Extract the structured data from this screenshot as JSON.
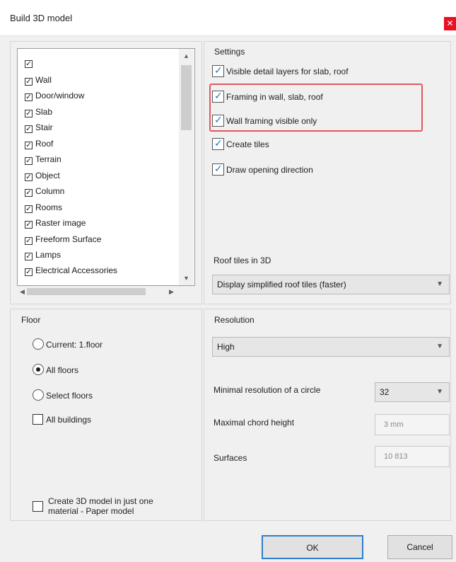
{
  "window": {
    "title": "Build 3D model",
    "close_glyph": "✕"
  },
  "elements_list": {
    "items": [
      {
        "label": "",
        "checked": true
      },
      {
        "label": "Wall",
        "checked": true
      },
      {
        "label": "Door/window",
        "checked": true
      },
      {
        "label": "Slab",
        "checked": true
      },
      {
        "label": "Stair",
        "checked": true
      },
      {
        "label": "Roof",
        "checked": true
      },
      {
        "label": "Terrain",
        "checked": true
      },
      {
        "label": "Object",
        "checked": true
      },
      {
        "label": "Column",
        "checked": true
      },
      {
        "label": "Rooms",
        "checked": true
      },
      {
        "label": "Raster image",
        "checked": true
      },
      {
        "label": "Freeform Surface",
        "checked": true
      },
      {
        "label": "Lamps",
        "checked": true
      },
      {
        "label": "Electrical Accessories",
        "checked": true
      }
    ]
  },
  "settings": {
    "title": "Settings",
    "options": [
      {
        "label": "Visible detail layers for slab, roof",
        "checked": true
      },
      {
        "label": "Framing in wall, slab, roof",
        "checked": true
      },
      {
        "label": "Wall framing visible only",
        "checked": true
      },
      {
        "label": "Create tiles",
        "checked": true
      },
      {
        "label": "Draw opening direction",
        "checked": true
      }
    ],
    "roof_tiles_label": "Roof tiles in 3D",
    "roof_tiles_value": "Display simplified roof tiles (faster)"
  },
  "floor": {
    "title": "Floor",
    "options": [
      {
        "label": "Current: 1.floor",
        "selected": false
      },
      {
        "label": "All floors",
        "selected": true
      },
      {
        "label": "Select floors",
        "selected": false
      }
    ],
    "all_buildings_label": "All buildings",
    "paper_model_label_1": "Create 3D model in just one",
    "paper_model_label_2": "material - Paper model"
  },
  "resolution": {
    "title": "Resolution",
    "value": "High",
    "min_circle_label": "Minimal resolution of a circle",
    "min_circle_value": "32",
    "max_chord_label": "Maximal chord height",
    "max_chord_value": "3 mm",
    "surfaces_label": "Surfaces",
    "surfaces_value": "10 813"
  },
  "buttons": {
    "ok": "OK",
    "cancel": "Cancel"
  },
  "colors": {
    "highlight": "#e0595f",
    "ok_border": "#2f7fd0",
    "close": "#e81123"
  }
}
